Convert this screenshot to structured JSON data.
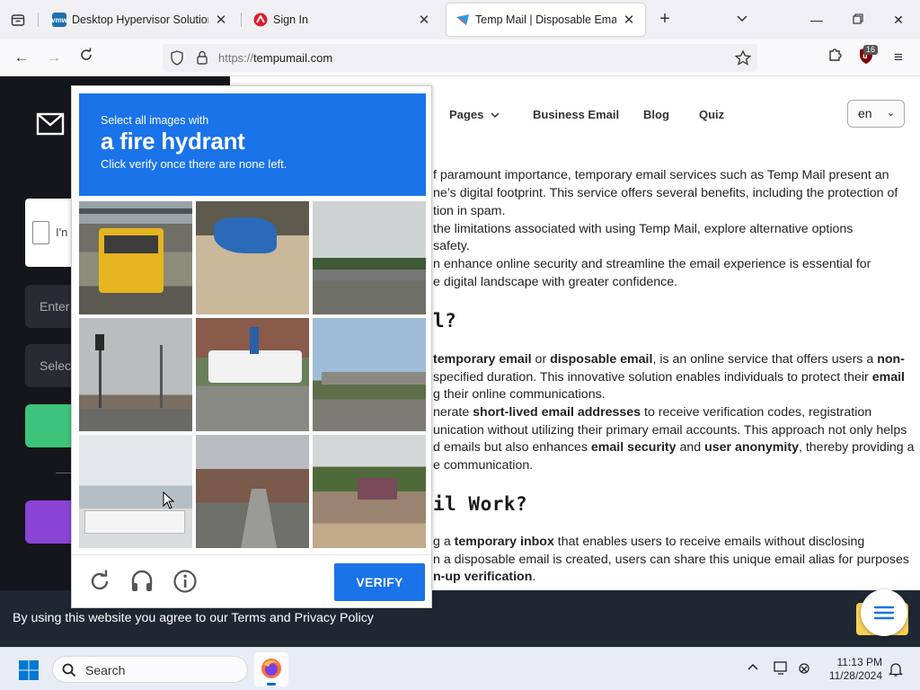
{
  "browser": {
    "tabs": [
      {
        "title": "Desktop Hypervisor Solutions |",
        "favicon_text": "vmw",
        "favicon_color": "#1d6fb0",
        "active": false
      },
      {
        "title": "Sign In",
        "favicon_text": "",
        "favicon_color": "#d81e2c",
        "active": false
      },
      {
        "title": "Temp Mail | Disposable Email A",
        "favicon_text": "",
        "favicon_color": "#2d9cdb",
        "active": true
      }
    ],
    "url_protocol": "https://",
    "url_host": "tempumail.com",
    "extension_badge": "16"
  },
  "site": {
    "nav": {
      "pages": "Pages",
      "business_email": "Business Email",
      "blog": "Blog",
      "quiz": "Quiz"
    },
    "language": "en",
    "left_panel": {
      "checkbox_label": "I'n",
      "input_placeholder": "Enter",
      "select_placeholder": "Selec"
    },
    "paragraphs_1": [
      "f paramount importance, temporary email services such as Temp Mail present an",
      "ne’s digital footprint. This service offers several benefits, including the protection of",
      "tion in spam.",
      "the limitations associated with using Temp Mail, explore alternative options",
      "safety.",
      "n enhance online security and streamline the email experience is essential for",
      "e digital landscape with greater confidence."
    ],
    "heading_1": "l?",
    "para2": {
      "l1a": "temporary email",
      "l1b": " or ",
      "l1c": "disposable email",
      "l1d": ", is an online service that offers users a ",
      "l1e": "non-",
      "l2a": "specified duration. This innovative solution enables individuals to protect their ",
      "l2b": "email",
      "l3": "g their online communications.",
      "l4a": "nerate ",
      "l4b": "short-lived email addresses",
      "l4c": " to receive verification codes, registration",
      "l5": "unication without utilizing their primary email accounts. This approach not only helps",
      "l6a": "d emails but also enhances ",
      "l6b": "email security",
      "l6c": " and ",
      "l6d": "user anonymity",
      "l6e": ", thereby providing a",
      "l7": "e communication."
    },
    "heading_2": "il Work?",
    "para3": {
      "l1a": "g a ",
      "l1b": "temporary inbox",
      "l1c": " that enables users to receive emails without disclosing",
      "l2": "n a disposable email is created, users can share this unique email alias for purposes",
      "l3": "n-up verification",
      "l3b": "."
    },
    "cookie_text": "By using this website you agree to our Terms and Privacy Policy"
  },
  "captcha": {
    "line1": "Select all images with",
    "target": "a fire hydrant",
    "line3": "Click verify once there are none left.",
    "verify_label": "VERIFY",
    "tiles": [
      "yellow bus under bridge",
      "blue tarp on sand",
      "overpass with trees",
      "traffic light intersection",
      "white bus near buildings",
      "highway overpass",
      "faded buses in parking lot",
      "residential street",
      "village street with shops"
    ]
  },
  "taskbar": {
    "search_label": "Search",
    "time": "11:13 PM",
    "date": "11/28/2024"
  },
  "colors": {
    "captcha_blue": "#1a73e8",
    "dark_panel": "#15151c",
    "cookie_bar": "#1f2733"
  }
}
